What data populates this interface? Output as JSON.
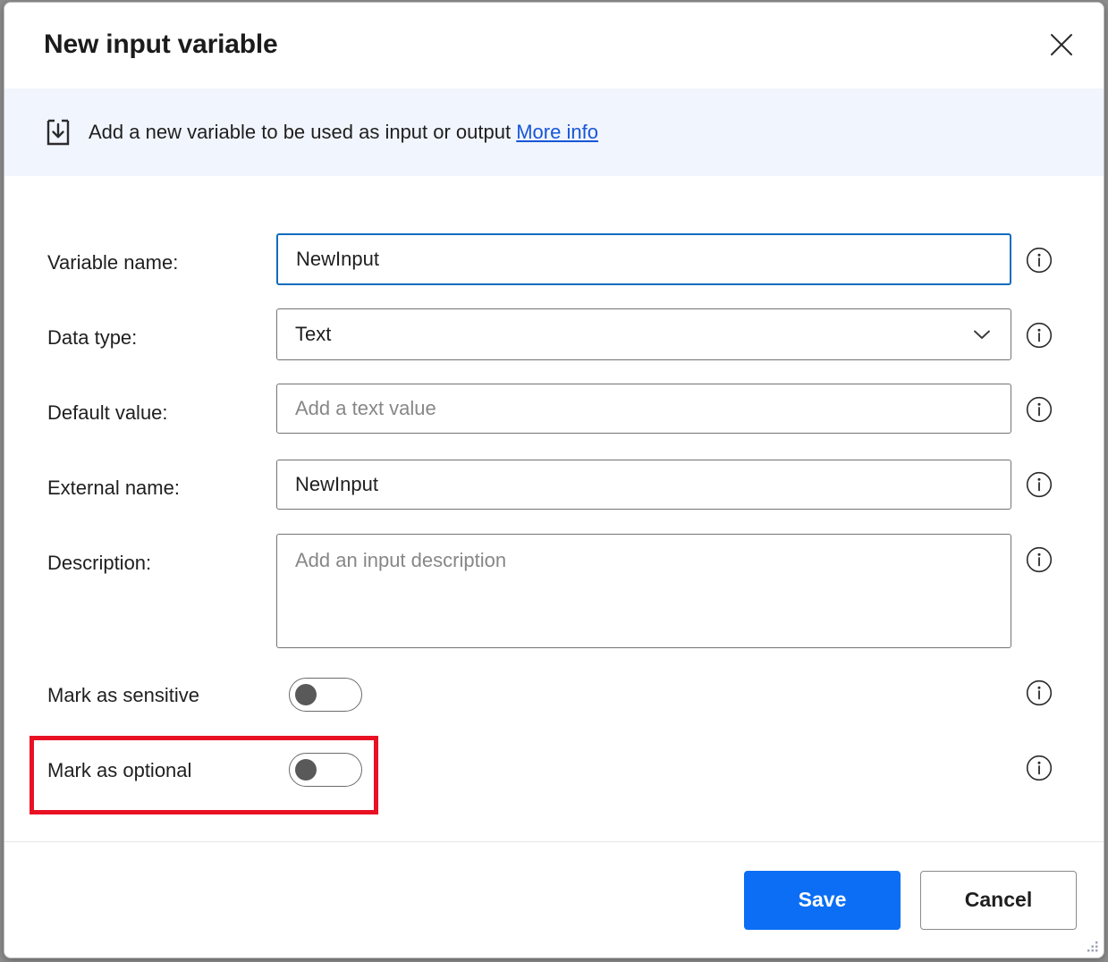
{
  "window": {
    "title": "New input variable",
    "close_label": "Close"
  },
  "banner": {
    "icon": "input-download-icon",
    "text": "Add a new variable to be used as input or output",
    "link_label": "More info"
  },
  "form": {
    "fields": [
      {
        "label": "Variable name:",
        "value": "NewInput",
        "placeholder": "",
        "type": "text",
        "focused": true,
        "info": "i"
      },
      {
        "label": "Data type:",
        "value": "Text",
        "placeholder": "",
        "type": "select",
        "focused": false,
        "info": "i"
      },
      {
        "label": "Default value:",
        "value": "",
        "placeholder": "Add a text value",
        "type": "text",
        "focused": false,
        "info": "i"
      },
      {
        "label": "External name:",
        "value": "NewInput",
        "placeholder": "",
        "type": "text",
        "focused": false,
        "info": "i"
      },
      {
        "label": "Description:",
        "value": "",
        "placeholder": "Add an input description",
        "type": "textarea",
        "focused": false,
        "info": "i"
      }
    ],
    "toggles": [
      {
        "label": "Mark as sensitive",
        "state": "off",
        "highlighted": false,
        "info": "i"
      },
      {
        "label": "Mark as optional",
        "state": "off",
        "highlighted": true,
        "info": "i"
      }
    ]
  },
  "footer": {
    "save_label": "Save",
    "cancel_label": "Cancel"
  },
  "colors": {
    "accent": "#0b6ef5",
    "link": "#1756d6",
    "banner_bg": "#f1f5fd",
    "highlight": "#e81123",
    "focus_border": "#0f6cbd"
  }
}
